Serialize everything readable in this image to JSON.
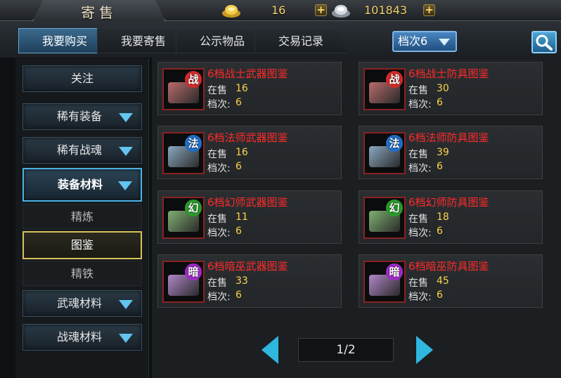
{
  "header": {
    "title": "寄售",
    "gold": {
      "icon": "gold-ingot-icon",
      "value": "16"
    },
    "silver": {
      "icon": "silver-ingot-icon",
      "value": "101843"
    }
  },
  "tabs": [
    {
      "label": "我要购买",
      "active": true
    },
    {
      "label": "我要寄售",
      "active": false
    },
    {
      "label": "公示物品",
      "active": false
    },
    {
      "label": "交易记录",
      "active": false
    }
  ],
  "grade_filter": {
    "label": "档次6"
  },
  "sidebar": {
    "follow": "关注",
    "categories": [
      {
        "label": "稀有装备"
      },
      {
        "label": "稀有战魂"
      },
      {
        "label": "装备材料",
        "expanded": true
      },
      {
        "label": "武魂材料"
      },
      {
        "label": "战魂材料"
      }
    ],
    "subitems": [
      {
        "label": "精炼",
        "selected": false
      },
      {
        "label": "图鉴",
        "selected": true
      },
      {
        "label": "精铁",
        "selected": false
      }
    ]
  },
  "items": [
    {
      "name": "6档战士武器图鉴",
      "glyph": "战",
      "glyph_color": "#d42a2a",
      "scroll_color": "#b86b6b",
      "on_sale_label": "在售",
      "on_sale": "16",
      "grade_label": "档次:",
      "grade": "6"
    },
    {
      "name": "6档战士防具图鉴",
      "glyph": "战",
      "glyph_color": "#d42a2a",
      "scroll_color": "#b86b6b",
      "on_sale_label": "在售",
      "on_sale": "30",
      "grade_label": "档次:",
      "grade": "6"
    },
    {
      "name": "6档法师武器图鉴",
      "glyph": "法",
      "glyph_color": "#1f6ec8",
      "scroll_color": "#8aa8c0",
      "on_sale_label": "在售",
      "on_sale": "16",
      "grade_label": "档次:",
      "grade": "6"
    },
    {
      "name": "6档法师防具图鉴",
      "glyph": "法",
      "glyph_color": "#1f6ec8",
      "scroll_color": "#8aa8c0",
      "on_sale_label": "在售",
      "on_sale": "39",
      "grade_label": "档次:",
      "grade": "6"
    },
    {
      "name": "6档幻师武器图鉴",
      "glyph": "幻",
      "glyph_color": "#2a9a2a",
      "scroll_color": "#7fb070",
      "on_sale_label": "在售",
      "on_sale": "11",
      "grade_label": "档次:",
      "grade": "6"
    },
    {
      "name": "6档幻师防具图鉴",
      "glyph": "幻",
      "glyph_color": "#2a9a2a",
      "scroll_color": "#7fb070",
      "on_sale_label": "在售",
      "on_sale": "18",
      "grade_label": "档次:",
      "grade": "6"
    },
    {
      "name": "6档暗巫武器图鉴",
      "glyph": "暗",
      "glyph_color": "#a02ac8",
      "scroll_color": "#b086c8",
      "on_sale_label": "在售",
      "on_sale": "33",
      "grade_label": "档次:",
      "grade": "6"
    },
    {
      "name": "6档暗巫防具图鉴",
      "glyph": "暗",
      "glyph_color": "#a02ac8",
      "scroll_color": "#b086c8",
      "on_sale_label": "在售",
      "on_sale": "45",
      "grade_label": "档次:",
      "grade": "6"
    }
  ],
  "pager": {
    "label": "1/2"
  }
}
